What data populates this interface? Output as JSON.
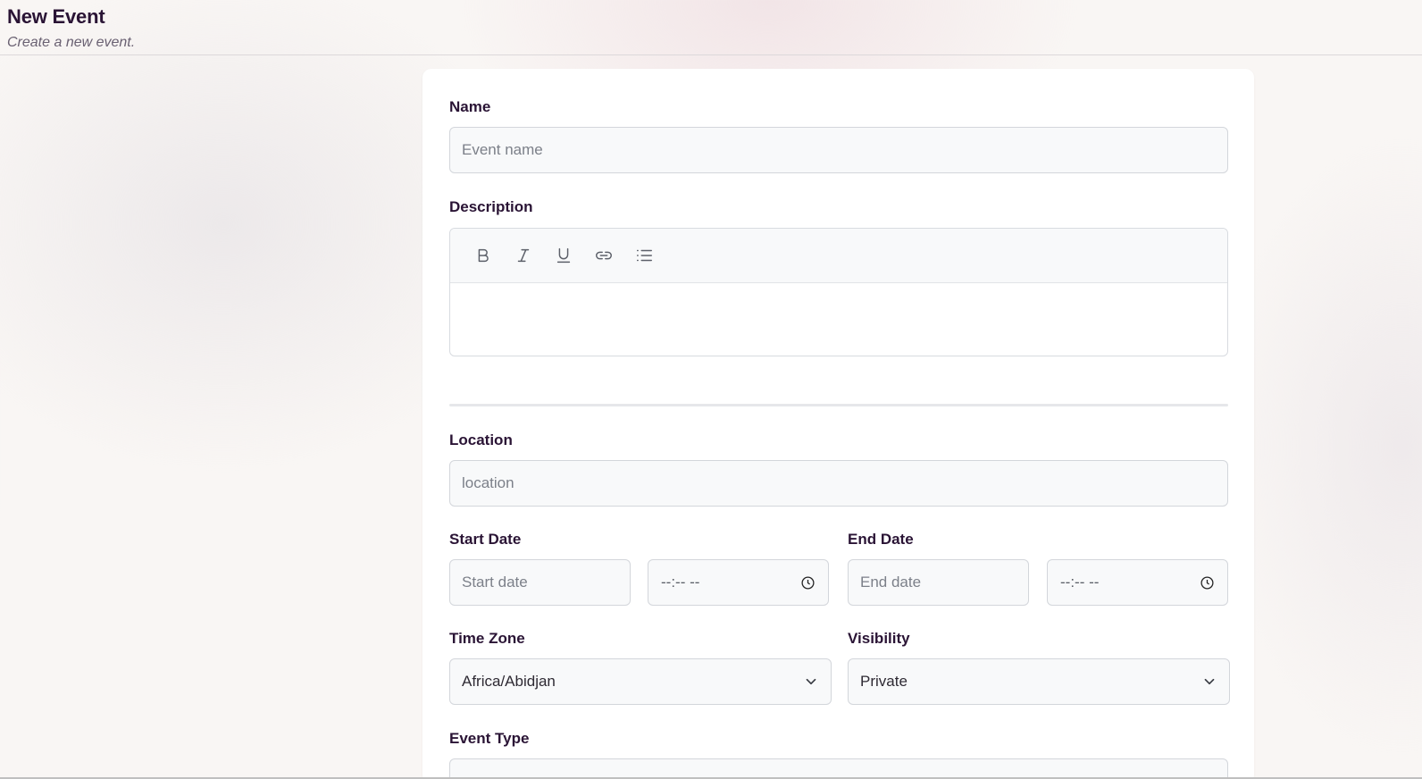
{
  "header": {
    "title": "New Event",
    "subtitle": "Create a new event."
  },
  "form": {
    "name": {
      "label": "Name",
      "placeholder": "Event name",
      "value": ""
    },
    "description": {
      "label": "Description",
      "toolbar": [
        "bold-icon",
        "italic-icon",
        "underline-icon",
        "link-icon",
        "list-icon"
      ]
    },
    "location": {
      "label": "Location",
      "placeholder": "location",
      "value": ""
    },
    "start": {
      "label": "Start Date",
      "date_placeholder": "Start date",
      "time_value": "--:-- --"
    },
    "end": {
      "label": "End Date",
      "date_placeholder": "End date",
      "time_value": "--:-- --"
    },
    "timezone": {
      "label": "Time Zone",
      "value": "Africa/Abidjan"
    },
    "visibility": {
      "label": "Visibility",
      "value": "Private"
    },
    "event_type": {
      "label": "Event Type"
    }
  }
}
